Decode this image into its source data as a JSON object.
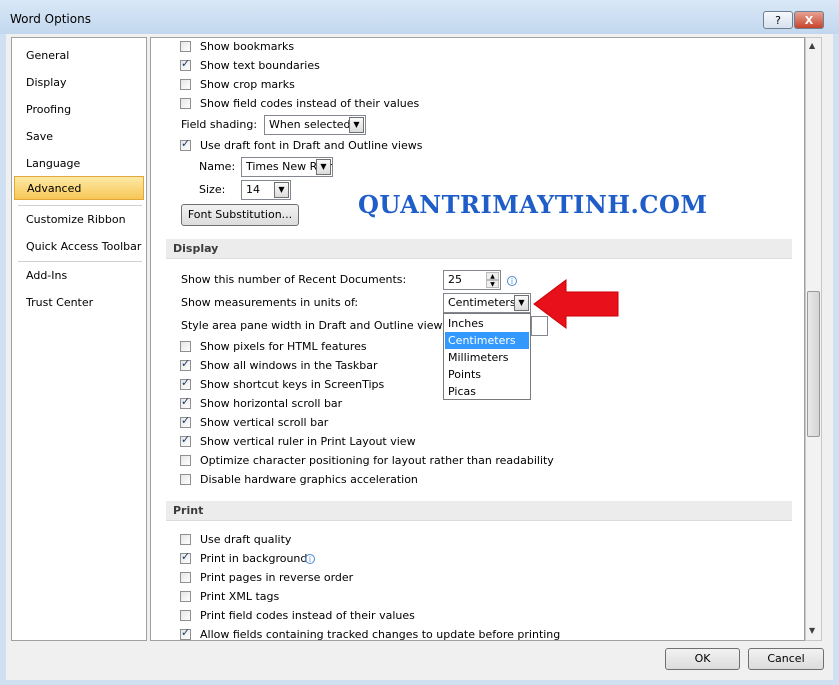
{
  "window": {
    "title": "Word Options",
    "help_btn": "?",
    "close_btn": "X"
  },
  "sidebar": {
    "items": [
      {
        "label": "General"
      },
      {
        "label": "Display"
      },
      {
        "label": "Proofing"
      },
      {
        "label": "Save"
      },
      {
        "label": "Language"
      },
      {
        "label": "Advanced"
      },
      {
        "label": "Customize Ribbon"
      },
      {
        "label": "Quick Access Toolbar"
      },
      {
        "label": "Add-Ins"
      },
      {
        "label": "Trust Center"
      }
    ],
    "selected": "Advanced"
  },
  "content_top": {
    "show_bookmarks": "Show bookmarks",
    "show_text_boundaries": "Show text boundaries",
    "show_crop_marks": "Show crop marks",
    "show_field_codes": "Show field codes instead of their values",
    "field_shading_label": "Field shading:",
    "field_shading_value": "When selected",
    "use_draft_font": "Use draft font in Draft and Outline views",
    "name_label": "Name:",
    "name_value": "Times New Roman",
    "size_label": "Size:",
    "size_value": "14",
    "font_substitution": "Font Substitution..."
  },
  "display_section": {
    "header": "Display",
    "recent_docs_label": "Show this number of Recent Documents:",
    "recent_docs_value": "25",
    "measurements_label": "Show measurements in units of:",
    "measurements_value": "Centimeters",
    "style_area_label": "Style area pane width in Draft and Outline views:",
    "dropdown_options": [
      "Inches",
      "Centimeters",
      "Millimeters",
      "Points",
      "Picas"
    ],
    "dropdown_selected": "Centimeters",
    "show_pixels": "Show pixels for HTML features",
    "show_all_windows": "Show all windows in the Taskbar",
    "show_shortcut_keys": "Show shortcut keys in ScreenTips",
    "show_h_scroll": "Show horizontal scroll bar",
    "show_v_scroll": "Show vertical scroll bar",
    "show_v_ruler": "Show vertical ruler in Print Layout view",
    "optimize_char": "Optimize character positioning for layout rather than readability",
    "disable_hw_accel": "Disable hardware graphics acceleration"
  },
  "print_section": {
    "header": "Print",
    "use_draft_quality": "Use draft quality",
    "print_in_background": "Print in background",
    "print_reverse": "Print pages in reverse order",
    "print_xml_tags": "Print XML tags",
    "print_field_codes": "Print field codes instead of their values",
    "allow_fields": "Allow fields containing tracked changes to update before printing"
  },
  "checkbox_states": {
    "show_bookmarks": false,
    "show_text_boundaries": true,
    "show_crop_marks": false,
    "show_field_codes": false,
    "use_draft_font": true,
    "show_pixels": false,
    "show_all_windows": true,
    "show_shortcut_keys": true,
    "show_h_scroll": true,
    "show_v_scroll": true,
    "show_v_ruler": true,
    "optimize_char": false,
    "disable_hw_accel": false,
    "use_draft_quality": false,
    "print_in_background": true,
    "print_reverse": false,
    "print_xml_tags": false,
    "print_field_codes": false,
    "allow_fields": true
  },
  "watermark": "QUANTRIMAYTINH.COM",
  "buttons": {
    "ok": "OK",
    "cancel": "Cancel"
  },
  "colors": {
    "arrow": "#e8101b",
    "selection": "#3399ff",
    "watermark": "#1f5dc8",
    "sidebar_selected": "#f7c756"
  }
}
